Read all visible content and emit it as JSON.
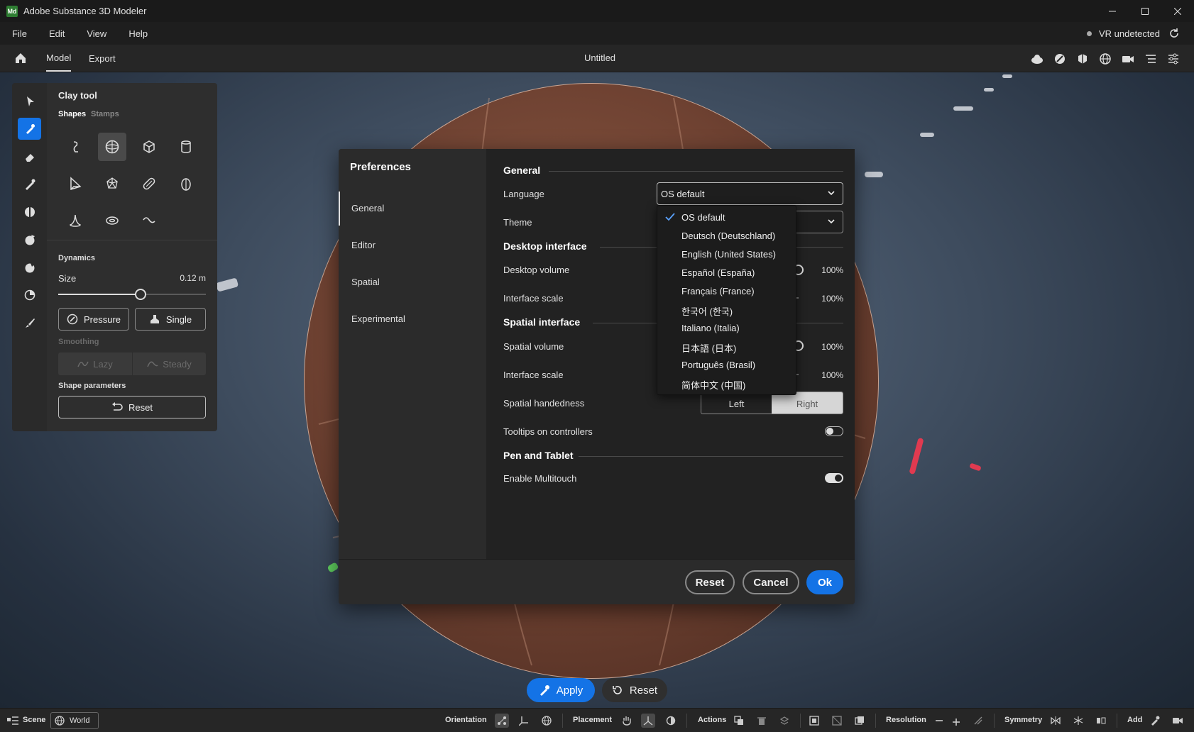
{
  "window": {
    "logo": "Md",
    "title": "Adobe Substance 3D Modeler",
    "minimize_icon": "minimize-icon",
    "maximize_icon": "maximize-icon",
    "close_icon": "close-icon"
  },
  "menu": {
    "items": [
      "File",
      "Edit",
      "View",
      "Help"
    ],
    "vr_status": "VR undetected"
  },
  "toolbar": {
    "tabs": [
      "Model",
      "Export"
    ],
    "active_tab": "Model",
    "doc_title": "Untitled"
  },
  "clay_panel": {
    "title": "Clay tool",
    "subtabs": [
      "Shapes",
      "Stamps"
    ],
    "active_subtab": "Shapes",
    "dynamics_label": "Dynamics",
    "size_label": "Size",
    "size_value": "0.12 m",
    "size_fraction": 0.56,
    "pressure_label": "Pressure",
    "single_label": "Single",
    "smoothing_label": "Smoothing",
    "lazy_label": "Lazy",
    "steady_label": "Steady",
    "shape_params_label": "Shape parameters",
    "reset_label": "Reset"
  },
  "preferences": {
    "title": "Preferences",
    "nav": [
      "General",
      "Editor",
      "Spatial",
      "Experimental"
    ],
    "active_nav": "General",
    "general_heading": "General",
    "language_label": "Language",
    "language_value": "OS default",
    "theme_label": "Theme",
    "desktop_heading": "Desktop interface",
    "desktop_volume_label": "Desktop volume",
    "desktop_volume_value": "100%",
    "desktop_scale_label": "Interface scale",
    "desktop_scale_value": "100%",
    "spatial_heading": "Spatial interface",
    "spatial_volume_label": "Spatial volume",
    "spatial_volume_value": "100%",
    "spatial_scale_label": "Interface scale",
    "spatial_scale_value": "100%",
    "handedness_label": "Spatial handedness",
    "handedness_left": "Left",
    "handedness_right": "Right",
    "handedness_selected": "Right",
    "tooltips_label": "Tooltips on controllers",
    "tooltips_on": false,
    "pen_heading": "Pen and Tablet",
    "multitouch_label": "Enable Multitouch",
    "multitouch_on": true,
    "reset_label": "Reset",
    "cancel_label": "Cancel",
    "ok_label": "Ok"
  },
  "language_menu": {
    "options": [
      "OS default",
      "Deutsch (Deutschland)",
      "English (United States)",
      "Español (España)",
      "Français (France)",
      "한국어 (한국)",
      "Italiano (Italia)",
      "日本語 (日本)",
      "Português (Brasil)",
      "简体中文 (中国)"
    ],
    "selected": "OS default"
  },
  "viewport_actions": {
    "apply_label": "Apply",
    "reset_label": "Reset"
  },
  "statusbar": {
    "scene": "Scene",
    "world": "World",
    "orientation": "Orientation",
    "placement": "Placement",
    "actions": "Actions",
    "resolution": "Resolution",
    "symmetry": "Symmetry",
    "add": "Add"
  },
  "colors": {
    "accent": "#1473e6",
    "clay": "#7a4a36"
  }
}
